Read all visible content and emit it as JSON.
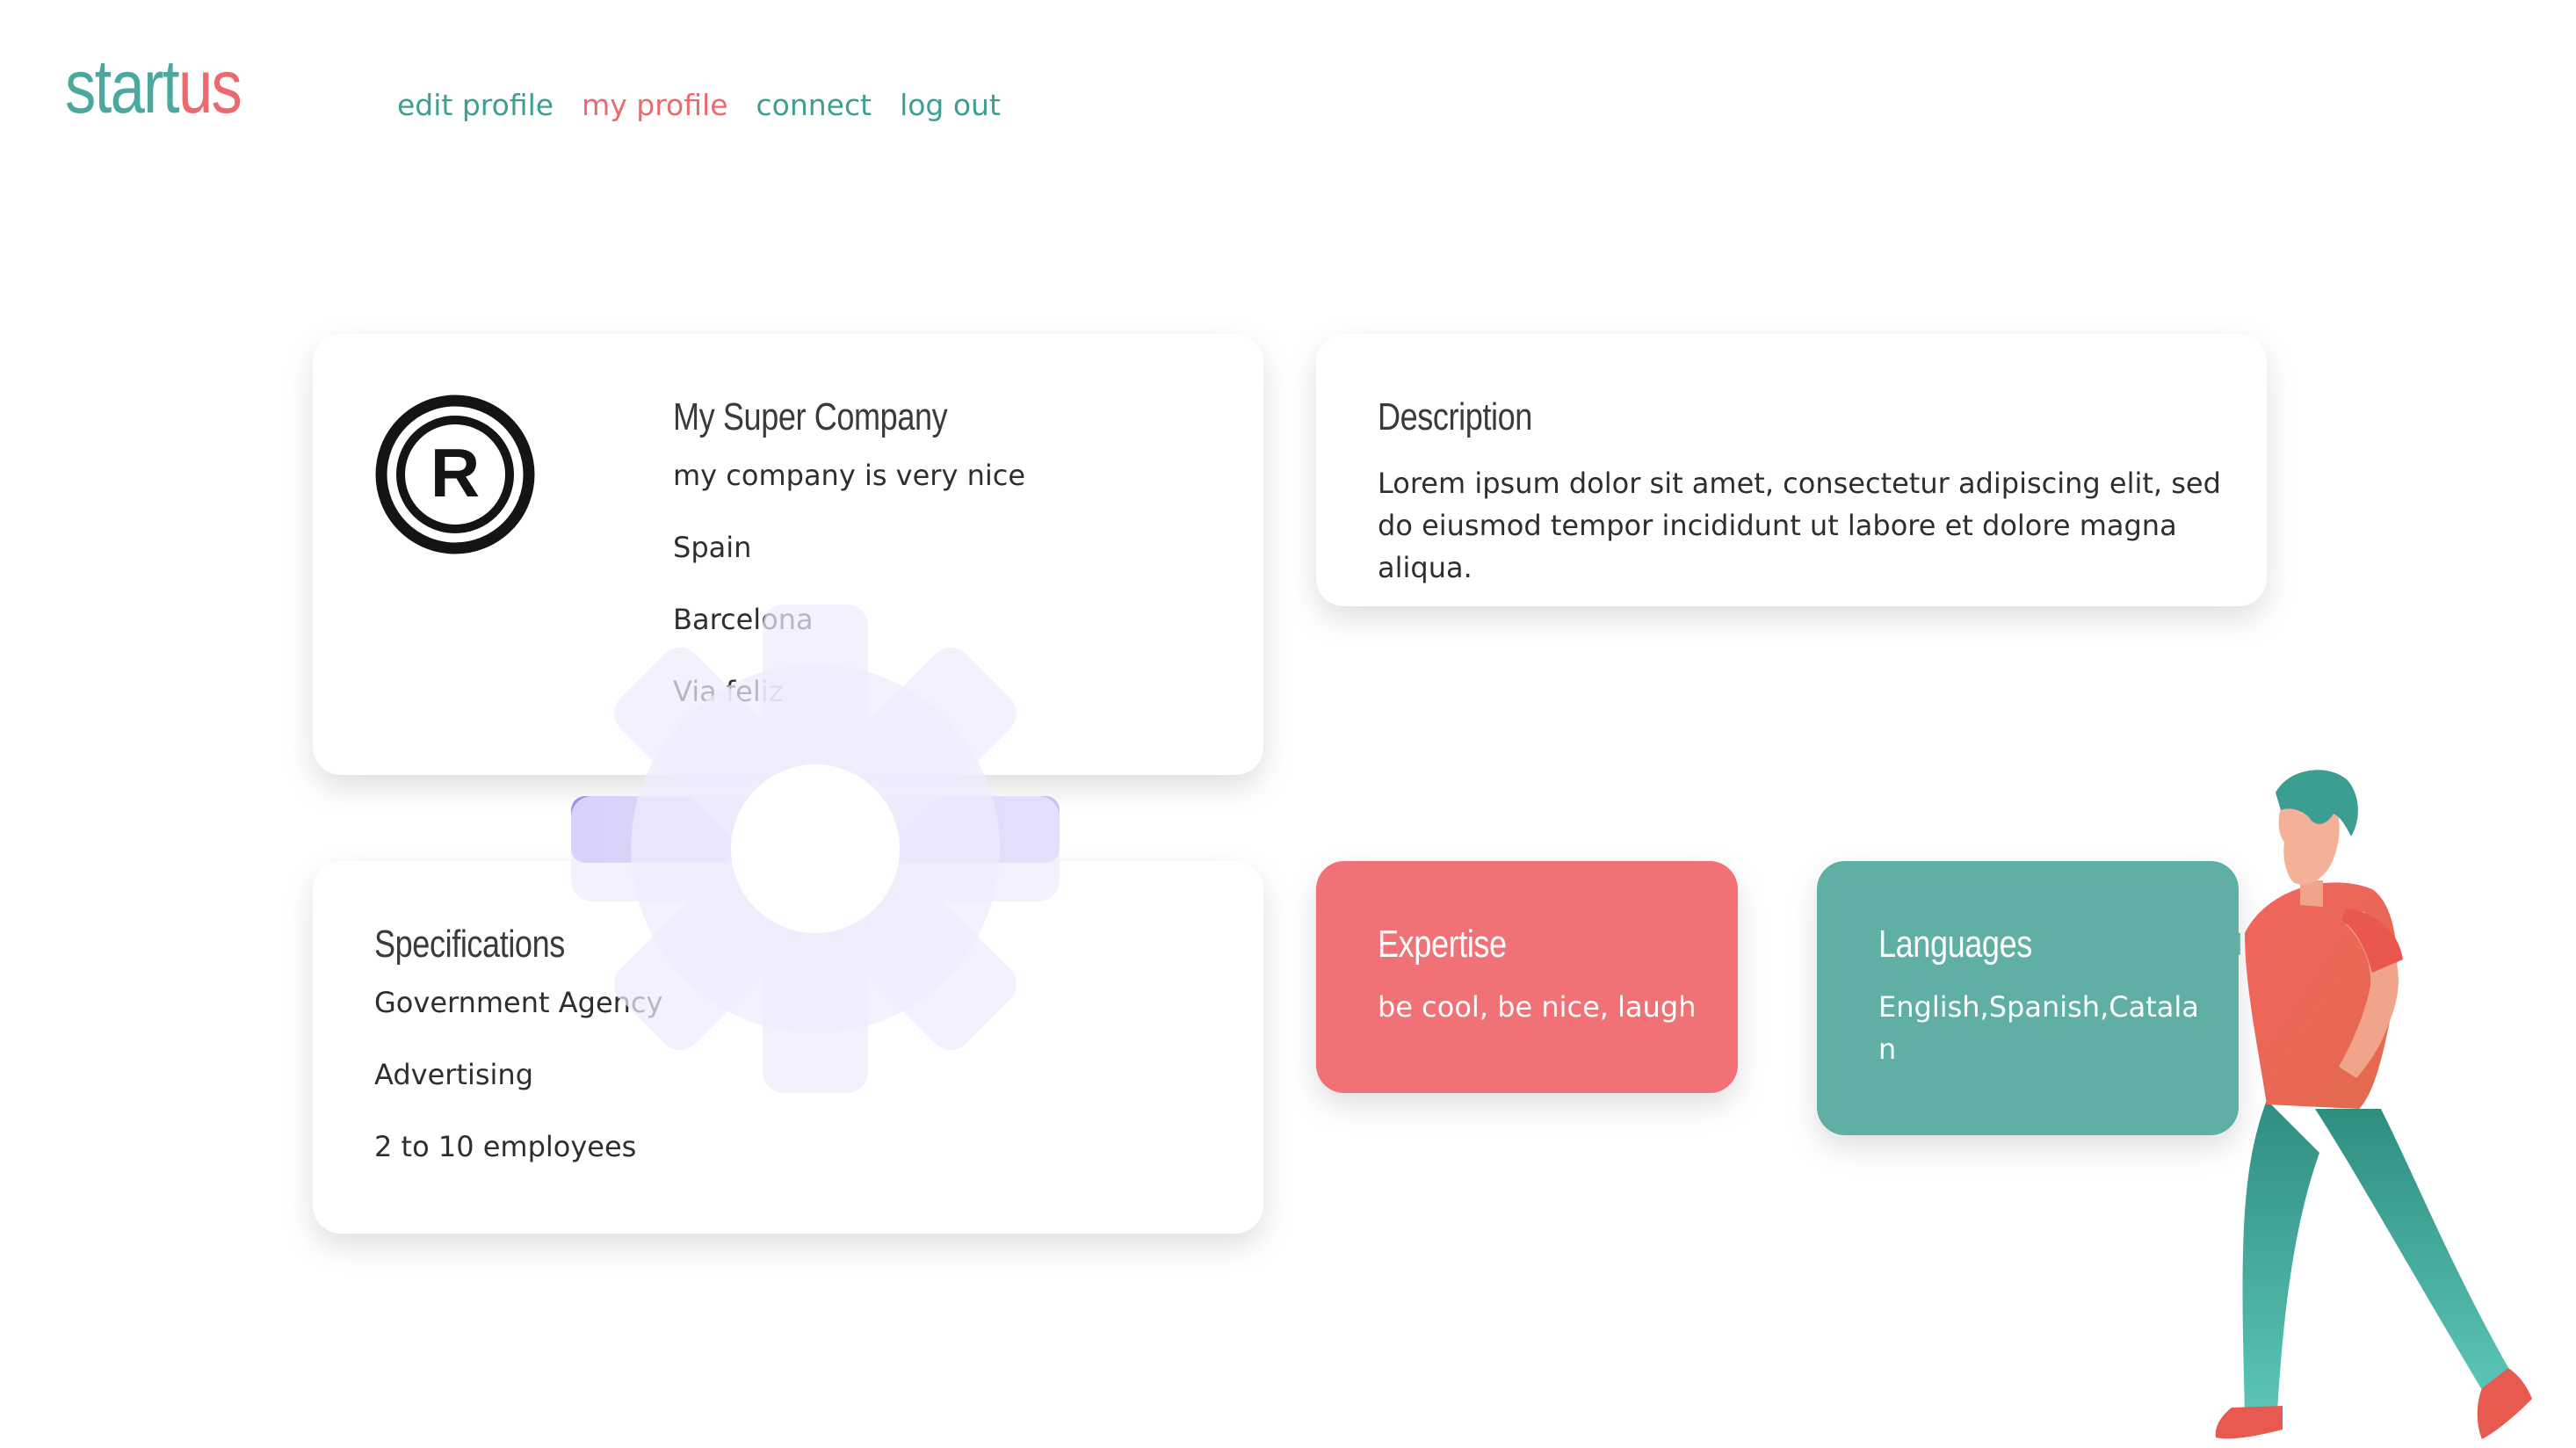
{
  "logo": {
    "part1": "start",
    "part2": "us"
  },
  "nav": {
    "edit_profile": "edit profile",
    "my_profile": "my profile",
    "connect": "connect",
    "log_out": "log out"
  },
  "company": {
    "name": "My Super Company",
    "tagline": "my company is very nice",
    "country": "Spain",
    "city": "Barcelona",
    "street": "Via feliz",
    "logo_icon": "registered-trademark-icon"
  },
  "description": {
    "title": "Description",
    "text": "Lorem ipsum dolor sit amet, consectetur adipiscing elit, sed do eiusmod tempor incididunt ut labore et dolore magna aliqua."
  },
  "specifications": {
    "title": "Specifications",
    "type": "Government Agency",
    "sector": "Advertising",
    "size": "2 to 10 employees"
  },
  "expertise": {
    "title": "Expertise",
    "text": "be cool, be nice, laugh"
  },
  "languages": {
    "title": "Languages",
    "text": "English,Spanish,Catalan"
  },
  "colors": {
    "teal": "#4aa89c",
    "coral": "#ec6a6f",
    "tile_red": "#f07277",
    "tile_teal": "#5fafa4",
    "gear_purple": "#a98bf0"
  },
  "illustrations": {
    "gear": "gear-illustration",
    "person": "walking-man-illustration"
  }
}
